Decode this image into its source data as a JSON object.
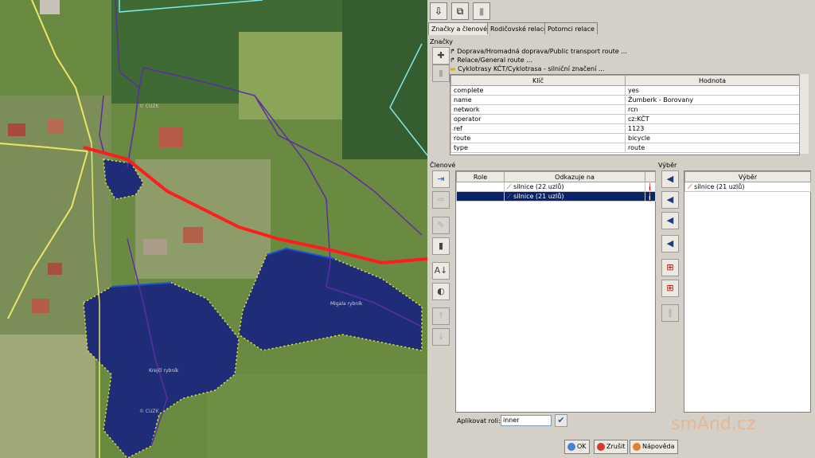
{
  "map": {
    "labels": {
      "lake1": "Krejčí rybník",
      "lake2": "Migala rybník",
      "cluzn1": "© CUZK",
      "cluzn2": "© CUZK"
    }
  },
  "toolbar": {
    "download_icon": "download-icon",
    "copy_icon": "copy-icon",
    "delete_icon": "delete-icon"
  },
  "tabs": [
    {
      "label": "Značky a členové"
    },
    {
      "label": "Rodičovské relace"
    },
    {
      "label": "Potomci relace"
    }
  ],
  "tags_section": {
    "title": "Značky",
    "presets": [
      "Doprava/Hromadná doprava/Public transport route ...",
      "Relace/General route ...",
      "Cyklotrasy KČT/Cyklotrasa - silniční značení ..."
    ],
    "columns": [
      "Klíč",
      "Hodnota"
    ],
    "rows": [
      {
        "key": "complete",
        "value": "yes"
      },
      {
        "key": "name",
        "value": "Žumberk - Borovany"
      },
      {
        "key": "network",
        "value": "rcn"
      },
      {
        "key": "operator",
        "value": "cz:KČT"
      },
      {
        "key": "ref",
        "value": "1123"
      },
      {
        "key": "route",
        "value": "bicycle"
      },
      {
        "key": "type",
        "value": "route"
      }
    ]
  },
  "members_section": {
    "title": "Členové",
    "columns": [
      "Role",
      "Odkazuje na"
    ],
    "rows": [
      {
        "role": "",
        "ref": "silnice (22 uzlů)",
        "selected": false
      },
      {
        "role": "",
        "ref": "silnice (21 uzlů)",
        "selected": true
      }
    ],
    "apply_role_label": "Aplikovat roli:",
    "apply_role_value": "inner"
  },
  "selection_section": {
    "title": "Výběr",
    "column": "Výběr",
    "rows": [
      "silnice (21 uzlů)"
    ]
  },
  "footer": {
    "ok": "OK",
    "cancel": "Zrušit",
    "help": "Nápověda"
  },
  "watermark": "smAnd.cz"
}
